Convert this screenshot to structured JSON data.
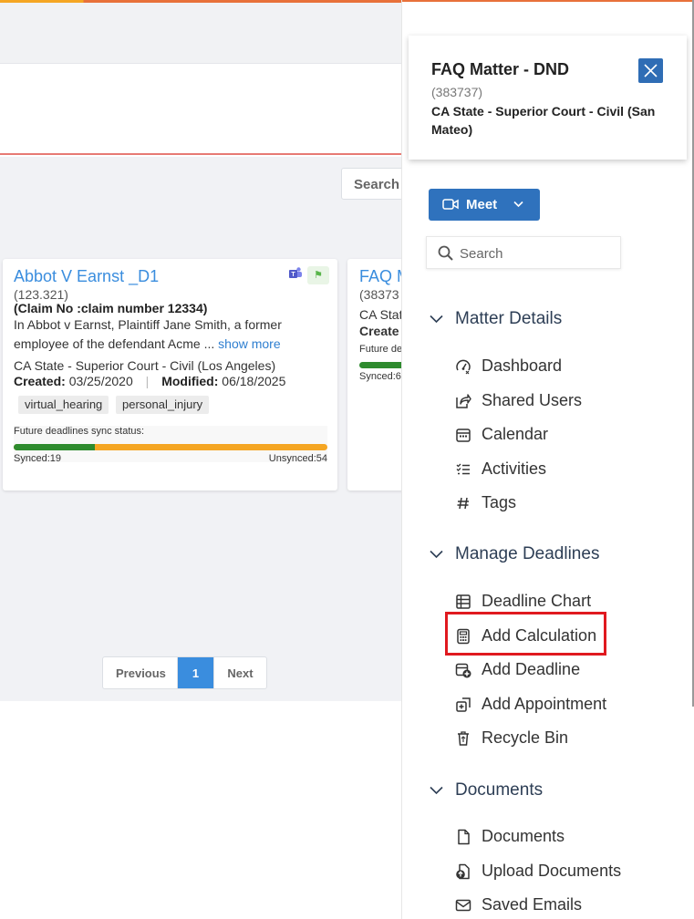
{
  "list": {
    "search_placeholder": "Search",
    "pagination": {
      "previous": "Previous",
      "current": "1",
      "next": "Next"
    },
    "cards": [
      {
        "title": "Abbot V Earnst _D1",
        "number": "(123.321)",
        "claim": "(Claim No :claim number 12334)",
        "description": "In Abbot v Earnst, Plaintiff Jane Smith, a former employee of the defendant Acme ...",
        "show_more": "show more",
        "court": "CA State - Superior Court - Civil (Los Angeles)",
        "created_label": "Created:",
        "created": "03/25/2020",
        "modified_label": "Modified:",
        "modified": "06/18/2025",
        "tags": [
          "virtual_hearing",
          "personal_injury"
        ],
        "sync_label": "Future deadlines sync status:",
        "synced": "Synced:19",
        "unsynced": "Unsynced:54",
        "synced_fraction": 0.26
      },
      {
        "title": "FAQ M",
        "number": "(38373",
        "court": "CA Stat",
        "created_label": "Create",
        "sync_label": "Future de",
        "synced": "Synced:6"
      }
    ]
  },
  "panel": {
    "matter": {
      "title": "FAQ Matter - DND",
      "number": "(383737)",
      "court": "CA State - Superior Court - Civil (San Mateo)"
    },
    "meet_label": "Meet",
    "search_placeholder": "Search",
    "sections": [
      {
        "label": "Matter Details",
        "items": [
          {
            "label": "Dashboard",
            "icon": "dashboard-icon"
          },
          {
            "label": "Shared Users",
            "icon": "share-icon"
          },
          {
            "label": "Calendar",
            "icon": "calendar-icon"
          },
          {
            "label": "Activities",
            "icon": "activities-icon"
          },
          {
            "label": "Tags",
            "icon": "hash-icon"
          }
        ]
      },
      {
        "label": "Manage Deadlines",
        "items": [
          {
            "label": "Deadline Chart",
            "icon": "table-icon"
          },
          {
            "label": "Add Calculation",
            "icon": "calculator-icon"
          },
          {
            "label": "Add Deadline",
            "icon": "calendar-plus-icon"
          },
          {
            "label": "Add Appointment",
            "icon": "appointment-icon"
          },
          {
            "label": "Recycle Bin",
            "icon": "trash-icon"
          }
        ]
      },
      {
        "label": "Documents",
        "items": [
          {
            "label": "Documents",
            "icon": "file-icon"
          },
          {
            "label": "Upload Documents",
            "icon": "upload-icon"
          },
          {
            "label": "Saved Emails",
            "icon": "mail-icon"
          }
        ]
      }
    ]
  },
  "colors": {
    "accent": "#2f72bd",
    "link": "#3a8dde",
    "highlight": "#e0191f",
    "synced": "#2e8b2e",
    "unsynced": "#f5a623"
  }
}
